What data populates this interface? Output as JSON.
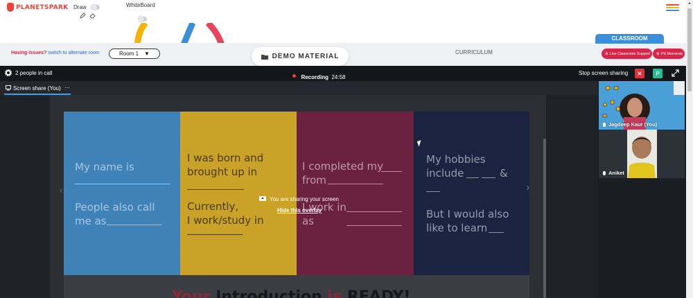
{
  "app": {
    "brand": "PLANETSPARK"
  },
  "toolbar": {
    "draw_label": "Draw",
    "whiteboard_label": "WhiteBoard",
    "menu_colors": [
      "#e8443a",
      "#f3b300",
      "#3a8fd8",
      "#2fae5b"
    ]
  },
  "class_bar": {
    "issues_prefix": "Having issues?",
    "issues_link": "switch to alternate room",
    "room_value": "Room 1",
    "demo_material_label": "DEMO MATERIAL",
    "curriculum_label": "CURRICULUM",
    "classroom_tab": "CLASSROOM",
    "live_support_label": "Live Classroom Support",
    "ps_moments_label": "PS Moments"
  },
  "call": {
    "people_in_call": "2 people in call",
    "recording_label": "Recording",
    "recording_time": "24:58",
    "stop_sharing_label": "Stop screen sharing",
    "stop_icon": "close-icon",
    "participant_initial": "P",
    "screen_share_tab": "Screen share (You)",
    "tab_more": "···",
    "overlay_message": "You are sharing your screen",
    "overlay_hide": "Hide this overlay",
    "accent_color": "#3aa0f0",
    "stop_color": "#e0303a",
    "participant_color": "#1fbf8f"
  },
  "slide": {
    "col1": {
      "line1": "My name is",
      "line2": "People also call",
      "line3": "me as",
      "color": "#3f82b8"
    },
    "col2": {
      "line1": "I was born and",
      "line2": "brought up in",
      "line3": "Currently,",
      "line4": "I work/study in",
      "color": "#c9a227"
    },
    "col3": {
      "line1": "I completed my",
      "line2": "from",
      "line3": "I work in",
      "line4": "as",
      "color": "#6b2140"
    },
    "col4": {
      "line1": "My hobbies",
      "line2": "include",
      "line2b": "&",
      "line3": "But I would also",
      "line4": "like to learn",
      "color": "#1a2340"
    },
    "title_word1": "Your",
    "title_word2": "Introduction",
    "title_word3": "is",
    "title_word4": "READY!"
  },
  "participants": [
    {
      "name": "Jagdeep Kaur (You)"
    },
    {
      "name": "Aniket"
    }
  ]
}
